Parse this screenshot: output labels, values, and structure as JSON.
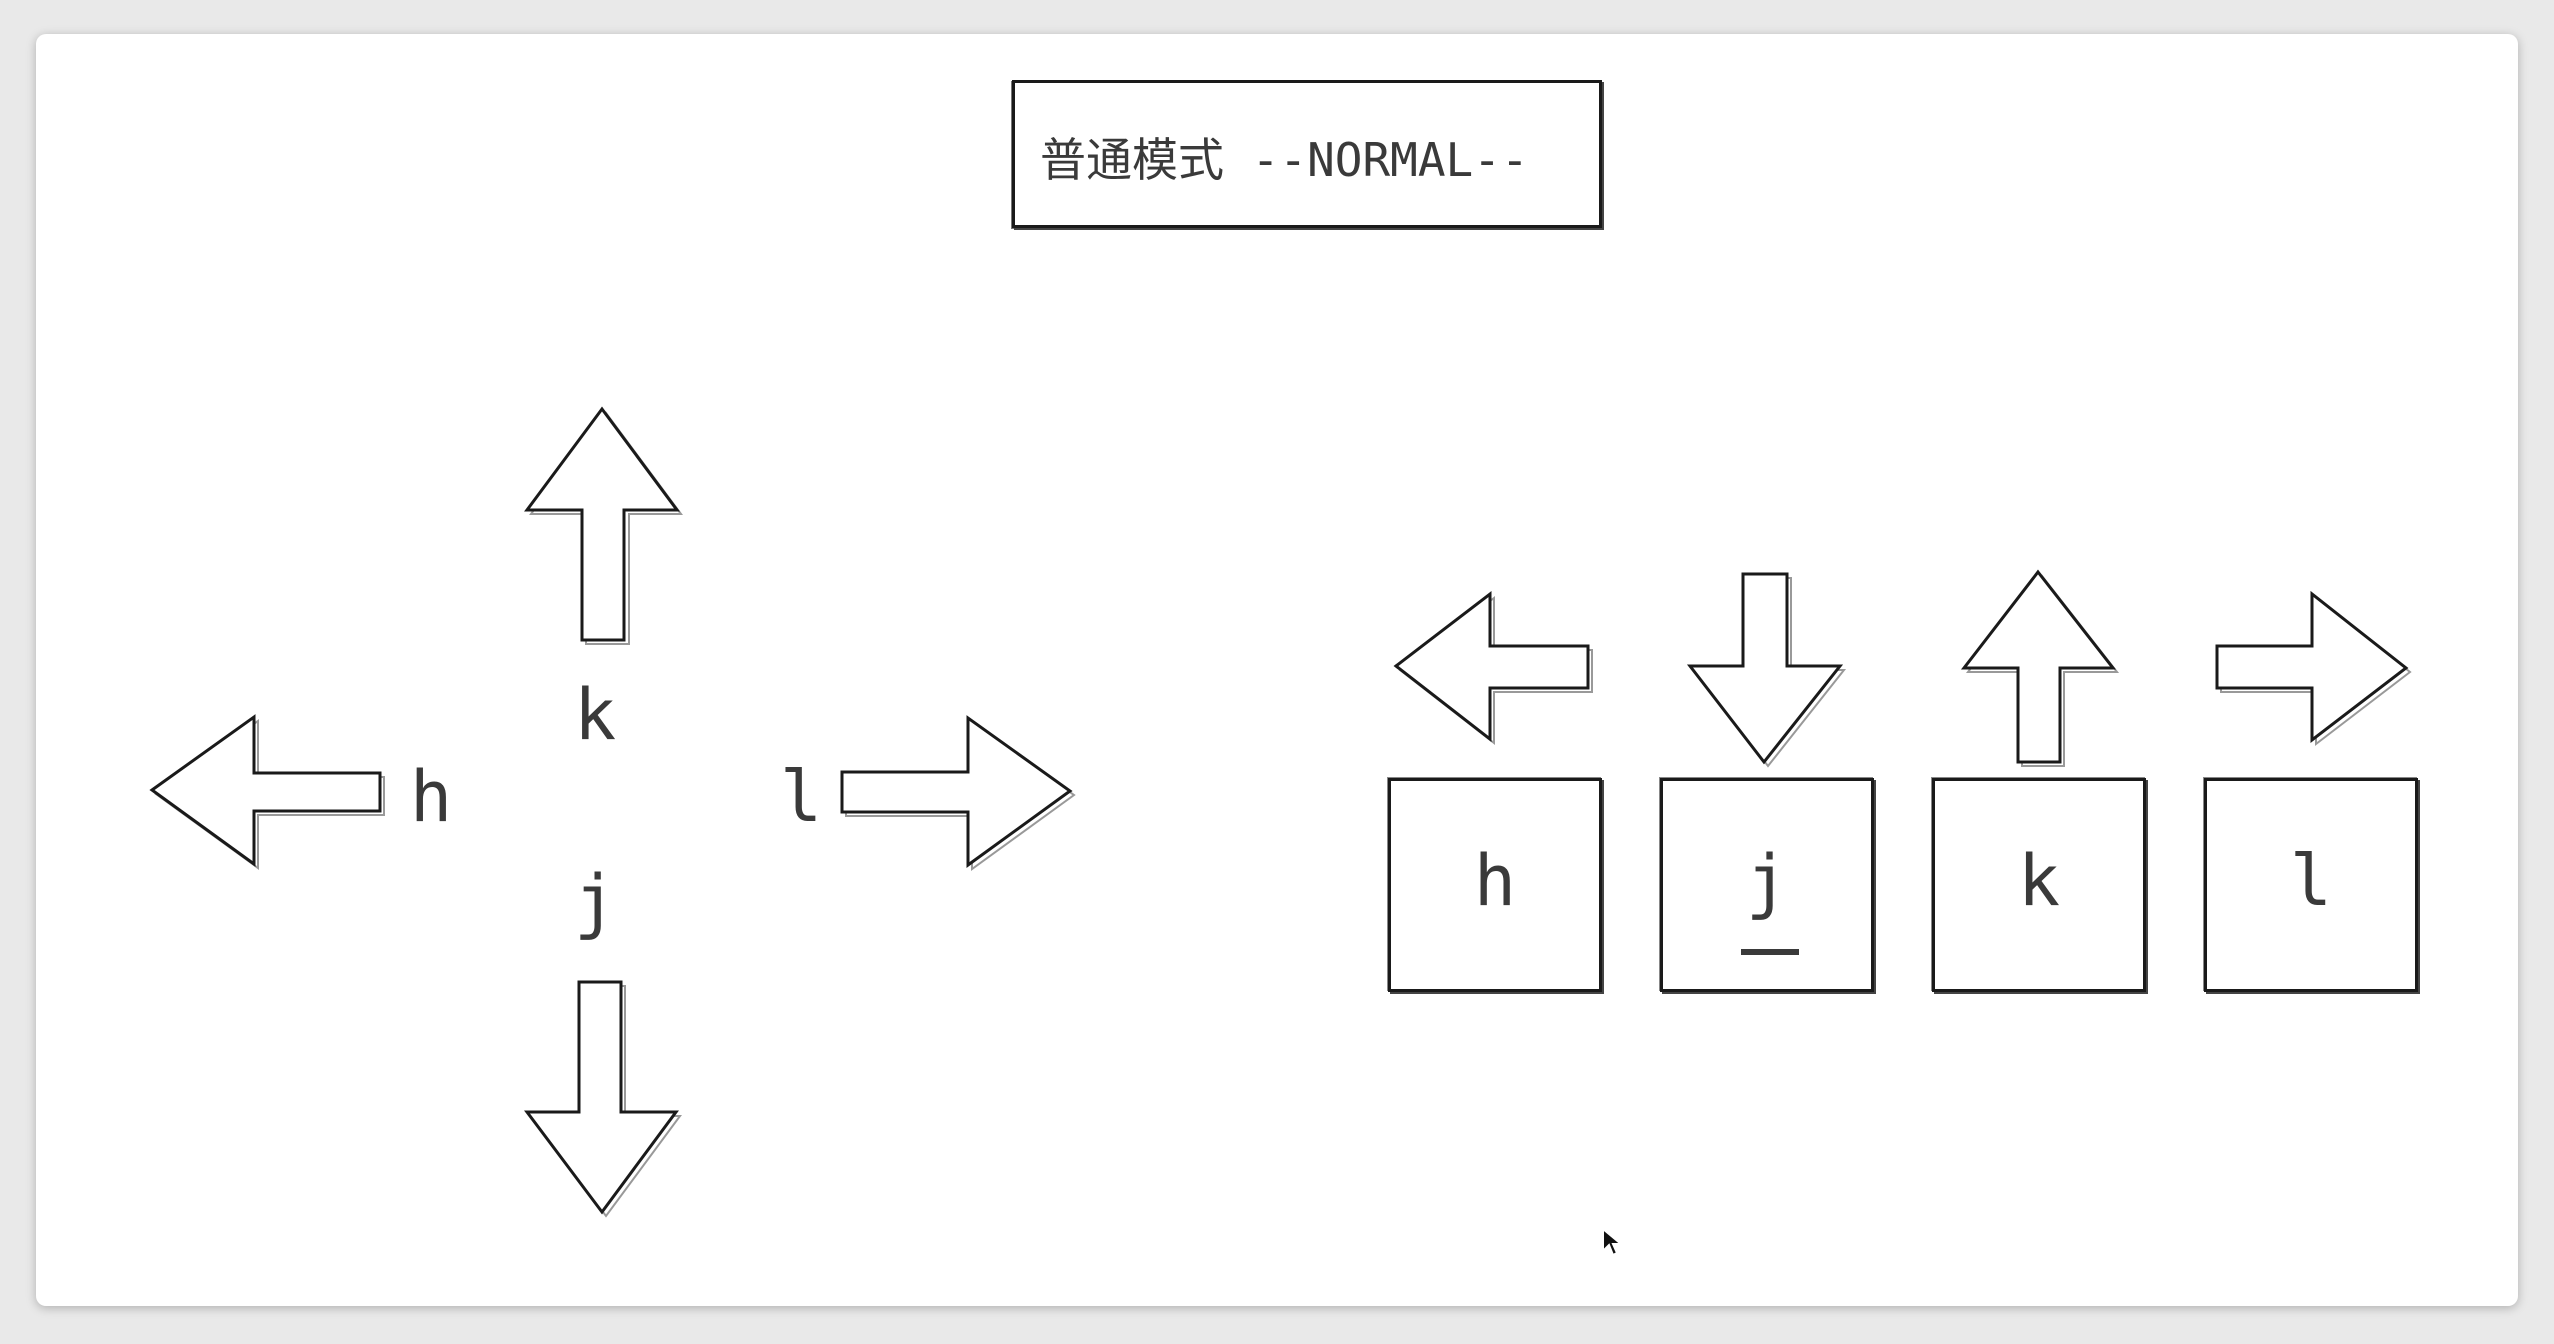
{
  "title": {
    "label": "普通模式 --NORMAL--"
  },
  "cross": {
    "up_label": "k",
    "down_label": "j",
    "left_label": "h",
    "right_label": "l"
  },
  "keys": [
    {
      "label": "h",
      "direction": "left"
    },
    {
      "label": "j",
      "direction": "down",
      "underlined": true
    },
    {
      "label": "k",
      "direction": "up"
    },
    {
      "label": "l",
      "direction": "right"
    }
  ],
  "colors": {
    "stroke": "#1a1a1a",
    "text": "#3a3a3a",
    "background": "#ffffff"
  }
}
